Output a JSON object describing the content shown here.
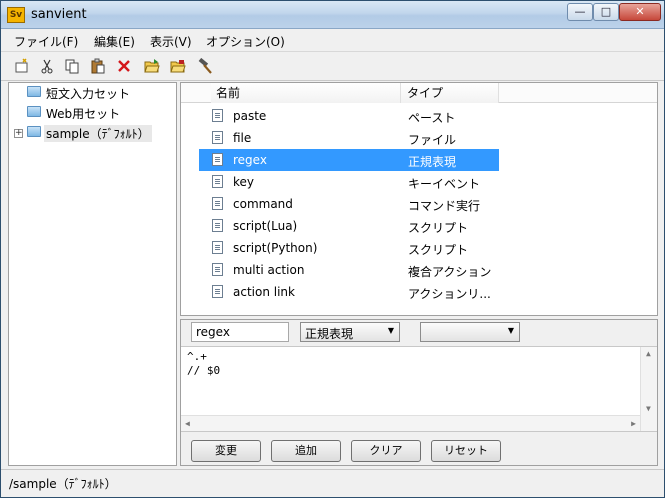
{
  "titlebar": {
    "logo_text": "Sv",
    "title": "sanvient",
    "minimize": "—",
    "maximize": "□",
    "close": "✕"
  },
  "menubar": {
    "items": [
      "ファイル(F)",
      "編集(E)",
      "表示(V)",
      "オプション(O)"
    ]
  },
  "toolbar": {
    "icons": [
      "new-icon",
      "cut-icon",
      "copy-icon",
      "paste-icon",
      "delete-icon",
      "open-folder-icon",
      "save-folder-icon",
      "tool-hammer-icon"
    ]
  },
  "sidebar": {
    "items": [
      {
        "label": "短文入力セット",
        "expandable": false
      },
      {
        "label": "Web用セット",
        "expandable": false
      },
      {
        "label": "sample（ﾃﾞﾌｫﾙﾄ）",
        "expandable": true,
        "selected": true
      }
    ]
  },
  "list": {
    "columns": [
      "名前",
      "タイプ"
    ],
    "rows": [
      {
        "name": "paste",
        "type": "ペースト"
      },
      {
        "name": "file",
        "type": "ファイル"
      },
      {
        "name": "regex",
        "type": "正規表現",
        "selected": true
      },
      {
        "name": "key",
        "type": "キーイベント"
      },
      {
        "name": "command",
        "type": "コマンド実行"
      },
      {
        "name": "script(Lua)",
        "type": "スクリプト"
      },
      {
        "name": "script(Python)",
        "type": "スクリプト"
      },
      {
        "name": "multi action",
        "type": "複合アクション"
      },
      {
        "name": "action link",
        "type": "アクションリ..."
      }
    ]
  },
  "editor": {
    "name_value": "regex",
    "type_select": "正規表現",
    "sub_select": "",
    "code_lines": [
      "^.+",
      "// $0"
    ],
    "buttons": {
      "change": "変更",
      "add": "追加",
      "clear": "クリア",
      "reset": "リセット"
    }
  },
  "status": {
    "path": "/sample（ﾃﾞﾌｫﾙﾄ）"
  },
  "colors": {
    "selection": "#3399ff",
    "titlebar": "#c1d6ec"
  }
}
